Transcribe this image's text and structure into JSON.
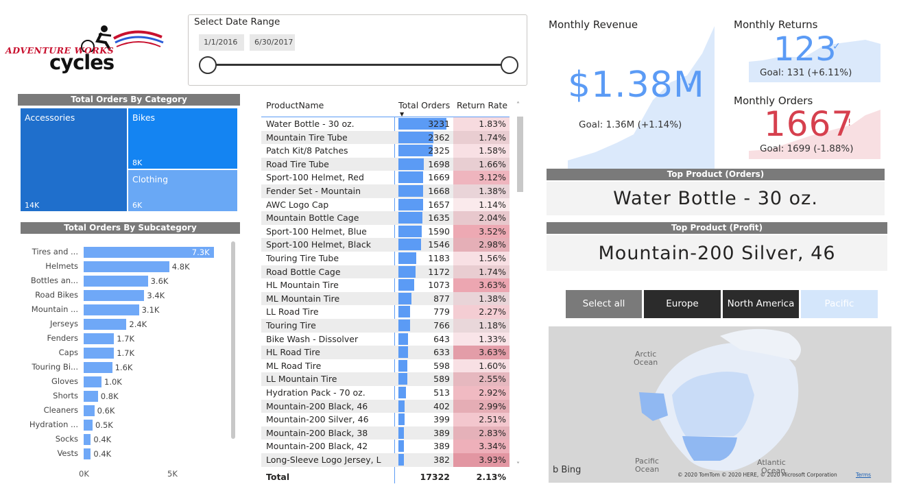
{
  "logo": {
    "line1": "ADVENTURE WORKS",
    "line2": "cycles"
  },
  "date_slicer": {
    "title": "Select Date Range",
    "start": "1/1/2016",
    "end": "6/30/2017"
  },
  "category": {
    "title": "Total Orders By Category",
    "tiles": [
      {
        "label": "Accessories",
        "value": "14K",
        "color": "#1f6fcc"
      },
      {
        "label": "Bikes",
        "value": "8K",
        "color": "#1484f2"
      },
      {
        "label": "Clothing",
        "value": "6K",
        "color": "#69a8f5"
      }
    ]
  },
  "subcategory": {
    "title": "Total Orders By Subcategory",
    "axis": [
      "0K",
      "5K"
    ],
    "rows": [
      {
        "label": "Tires and ...",
        "value": 7.3,
        "text": "7.3K",
        "selected": true
      },
      {
        "label": "Helmets",
        "value": 4.8,
        "text": "4.8K"
      },
      {
        "label": "Bottles an...",
        "value": 3.6,
        "text": "3.6K"
      },
      {
        "label": "Road Bikes",
        "value": 3.4,
        "text": "3.4K"
      },
      {
        "label": "Mountain ...",
        "value": 3.1,
        "text": "3.1K"
      },
      {
        "label": "Jerseys",
        "value": 2.4,
        "text": "2.4K"
      },
      {
        "label": "Fenders",
        "value": 1.7,
        "text": "1.7K"
      },
      {
        "label": "Caps",
        "value": 1.7,
        "text": "1.7K"
      },
      {
        "label": "Touring Bi...",
        "value": 1.6,
        "text": "1.6K"
      },
      {
        "label": "Gloves",
        "value": 1.0,
        "text": "1.0K"
      },
      {
        "label": "Shorts",
        "value": 0.8,
        "text": "0.8K"
      },
      {
        "label": "Cleaners",
        "value": 0.6,
        "text": "0.6K"
      },
      {
        "label": "Hydration ...",
        "value": 0.5,
        "text": "0.5K"
      },
      {
        "label": "Socks",
        "value": 0.4,
        "text": "0.4K"
      },
      {
        "label": "Vests",
        "value": 0.4,
        "text": "0.4K"
      }
    ]
  },
  "table": {
    "headers": {
      "name": "ProductName",
      "orders": "Total Orders",
      "rate": "Return Rate"
    },
    "max_orders": 3231,
    "rows": [
      {
        "name": "Water Bottle - 30 oz.",
        "orders": 3231,
        "rate": "1.83%",
        "heat": 0.18
      },
      {
        "name": "Mountain Tire Tube",
        "orders": 2362,
        "rate": "1.74%",
        "heat": 0.16
      },
      {
        "name": "Patch Kit/8 Patches",
        "orders": 2325,
        "rate": "1.58%",
        "heat": 0.12
      },
      {
        "name": "Road Tire Tube",
        "orders": 1698,
        "rate": "1.66%",
        "heat": 0.14
      },
      {
        "name": "Sport-100 Helmet, Red",
        "orders": 1669,
        "rate": "3.12%",
        "heat": 0.6
      },
      {
        "name": "Fender Set - Mountain",
        "orders": 1668,
        "rate": "1.38%",
        "heat": 0.08
      },
      {
        "name": "AWC Logo Cap",
        "orders": 1657,
        "rate": "1.14%",
        "heat": 0.02
      },
      {
        "name": "Mountain Bottle Cage",
        "orders": 1635,
        "rate": "2.04%",
        "heat": 0.24
      },
      {
        "name": "Sport-100 Helmet, Blue",
        "orders": 1590,
        "rate": "3.52%",
        "heat": 0.72
      },
      {
        "name": "Sport-100 Helmet, Black",
        "orders": 1546,
        "rate": "2.98%",
        "heat": 0.55
      },
      {
        "name": "Touring Tire Tube",
        "orders": 1183,
        "rate": "1.56%",
        "heat": 0.12
      },
      {
        "name": "Road Bottle Cage",
        "orders": 1172,
        "rate": "1.74%",
        "heat": 0.16
      },
      {
        "name": "HL Mountain Tire",
        "orders": 1073,
        "rate": "3.63%",
        "heat": 0.76
      },
      {
        "name": "ML Mountain Tire",
        "orders": 877,
        "rate": "1.38%",
        "heat": 0.08
      },
      {
        "name": "LL Road Tire",
        "orders": 779,
        "rate": "2.27%",
        "heat": 0.32
      },
      {
        "name": "Touring Tire",
        "orders": 766,
        "rate": "1.18%",
        "heat": 0.03
      },
      {
        "name": "Bike Wash - Dissolver",
        "orders": 643,
        "rate": "1.33%",
        "heat": 0.07
      },
      {
        "name": "HL Road Tire",
        "orders": 633,
        "rate": "3.63%",
        "heat": 0.76
      },
      {
        "name": "ML Road Tire",
        "orders": 598,
        "rate": "1.60%",
        "heat": 0.13
      },
      {
        "name": "LL Mountain Tire",
        "orders": 589,
        "rate": "2.55%",
        "heat": 0.42
      },
      {
        "name": "Hydration Pack - 70 oz.",
        "orders": 513,
        "rate": "2.92%",
        "heat": 0.54
      },
      {
        "name": "Mountain-200 Black, 46",
        "orders": 402,
        "rate": "2.99%",
        "heat": 0.56
      },
      {
        "name": "Mountain-200 Silver, 46",
        "orders": 399,
        "rate": "2.51%",
        "heat": 0.4
      },
      {
        "name": "Mountain-200 Black, 38",
        "orders": 389,
        "rate": "2.83%",
        "heat": 0.5
      },
      {
        "name": "Mountain-200 Black, 42",
        "orders": 389,
        "rate": "3.34%",
        "heat": 0.66
      },
      {
        "name": "Long-Sleeve Logo Jersey, L",
        "orders": 382,
        "rate": "3.93%",
        "heat": 0.86
      }
    ],
    "total": {
      "label": "Total",
      "orders": "17322",
      "rate": "2.13%"
    }
  },
  "kpis": {
    "revenue": {
      "title": "Monthly Revenue",
      "value": "$1.38M",
      "mark": "✓",
      "goal": "Goal: 1.36M (+1.14%)",
      "color": "#5b9bf5"
    },
    "returns": {
      "title": "Monthly Returns",
      "value": "123",
      "mark": "✓",
      "goal": "Goal: 131 (+6.11%)",
      "color": "#5b9bf5"
    },
    "orders": {
      "title": "Monthly Orders",
      "value": "1667",
      "mark": "!",
      "goal": "Goal: 1699 (-1.88%)",
      "color": "#d6404e"
    }
  },
  "top_product_orders": {
    "title": "Top Product (Orders)",
    "value": "Water Bottle - 30 oz."
  },
  "top_product_profit": {
    "title": "Top Product (Profit)",
    "value": "Mountain-200 Silver, 46"
  },
  "regions": [
    {
      "label": "Select all",
      "bg": "#7a7a7a",
      "fg": "#ffffff"
    },
    {
      "label": "Europe",
      "bg": "#2b2b2b",
      "fg": "#ffffff"
    },
    {
      "label": "North America",
      "bg": "#2b2b2b",
      "fg": "#ffffff"
    },
    {
      "label": "Pacific",
      "bg": "#d4e6fb",
      "fg": "#ffffff"
    }
  ],
  "map": {
    "labels": [
      "Arctic",
      "Ocean",
      "Pacific",
      "Ocean",
      "Atlantic",
      "Ocean"
    ],
    "bing": "Bing",
    "copyright": "© 2020 TomTom © 2020 HERE, © 2020 Microsoft Corporation",
    "terms": "Terms"
  }
}
